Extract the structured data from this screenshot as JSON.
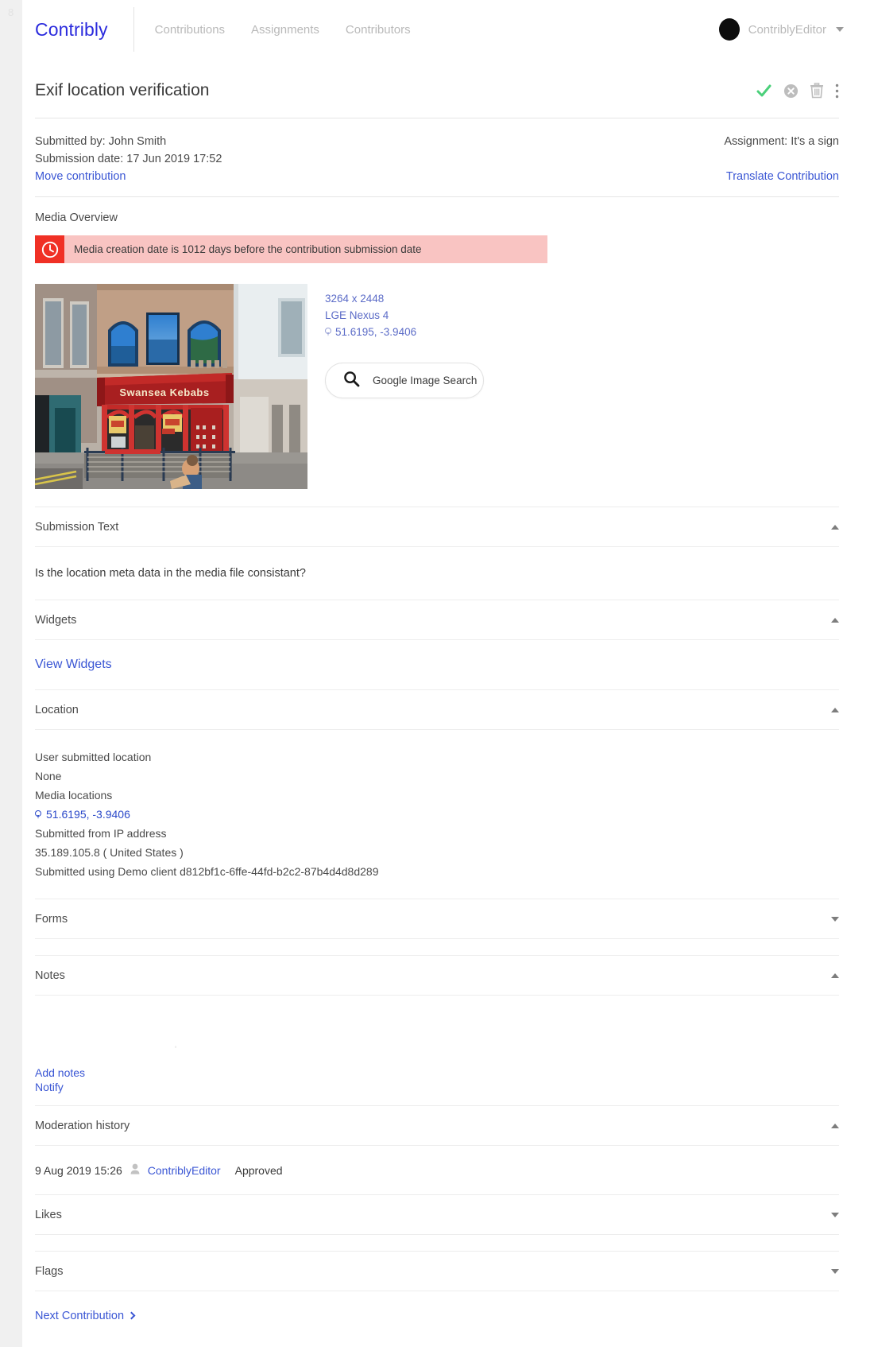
{
  "gutter": {
    "mark": "8"
  },
  "nav": {
    "brand": "Contribly",
    "links": [
      {
        "label": "Contributions"
      },
      {
        "label": "Assignments"
      },
      {
        "label": "Contributors"
      }
    ],
    "user": {
      "name": "ContriblyEditor"
    }
  },
  "header": {
    "title": "Exif location verification",
    "actions": [
      {
        "icon": "approve-check-icon"
      },
      {
        "icon": "reject-circle-x-icon"
      },
      {
        "icon": "delete-trash-icon"
      },
      {
        "icon": "more-vertical-icon"
      }
    ]
  },
  "meta": {
    "submitted_by": "Submitted by: John Smith",
    "submission_date": "Submission date: 17 Jun 2019 17:52",
    "assignment": "Assignment: It's a sign",
    "move_contribution": "Move contribution",
    "translate_contribution": "Translate Contribution"
  },
  "media_overview": {
    "label": "Media Overview",
    "alert": {
      "icon": "clock-alert-icon",
      "text": "Media creation date is 1012 days before the contribution submission date",
      "bg_color": "#f9c4c2",
      "icon_bg_color": "#f03025"
    },
    "thumbnail": {
      "alt": "Swansea Kebabs storefront",
      "sign_text": "Swansea Kebabs"
    },
    "info": {
      "dimensions": "3264 x 2448",
      "device": "LGE Nexus 4",
      "coordinates": "51.6195, -3.9406"
    },
    "google_image_search": "Google Image Search"
  },
  "sections": {
    "submission_text": {
      "title": "Submission Text",
      "expanded": true,
      "body": "Is the location meta data in the media file consistant?"
    },
    "widgets": {
      "title": "Widgets",
      "expanded": true,
      "view_link": "View Widgets"
    },
    "location": {
      "title": "Location",
      "expanded": true,
      "user_submitted_label": "User submitted location",
      "user_submitted_value": "None",
      "media_locations_label": "Media locations",
      "media_location_value": "51.6195, -3.9406",
      "ip_label": "Submitted from IP address",
      "ip_value": "35.189.105.8 ( United States )",
      "client_line": "Submitted using Demo client d812bf1c-6ffe-44fd-b2c2-87b4d4d8d289"
    },
    "forms": {
      "title": "Forms",
      "expanded": false
    },
    "notes": {
      "title": "Notes",
      "expanded": true,
      "artifact": "'",
      "add_notes": "Add notes",
      "notify": "Notify"
    },
    "moderation_history": {
      "title": "Moderation history",
      "expanded": true,
      "entries": [
        {
          "date": "9 Aug 2019 15:26",
          "user": "ContriblyEditor",
          "status": "Approved"
        }
      ]
    },
    "likes": {
      "title": "Likes",
      "expanded": false
    },
    "flags": {
      "title": "Flags",
      "expanded": false
    }
  },
  "footer": {
    "next_contribution": "Next Contribution"
  },
  "colors": {
    "brand": "#2b2bdd",
    "link": "#3a56d4",
    "approve_green": "#4bd07a",
    "alert_red": "#f03025",
    "alert_bg": "#f9c4c2"
  }
}
